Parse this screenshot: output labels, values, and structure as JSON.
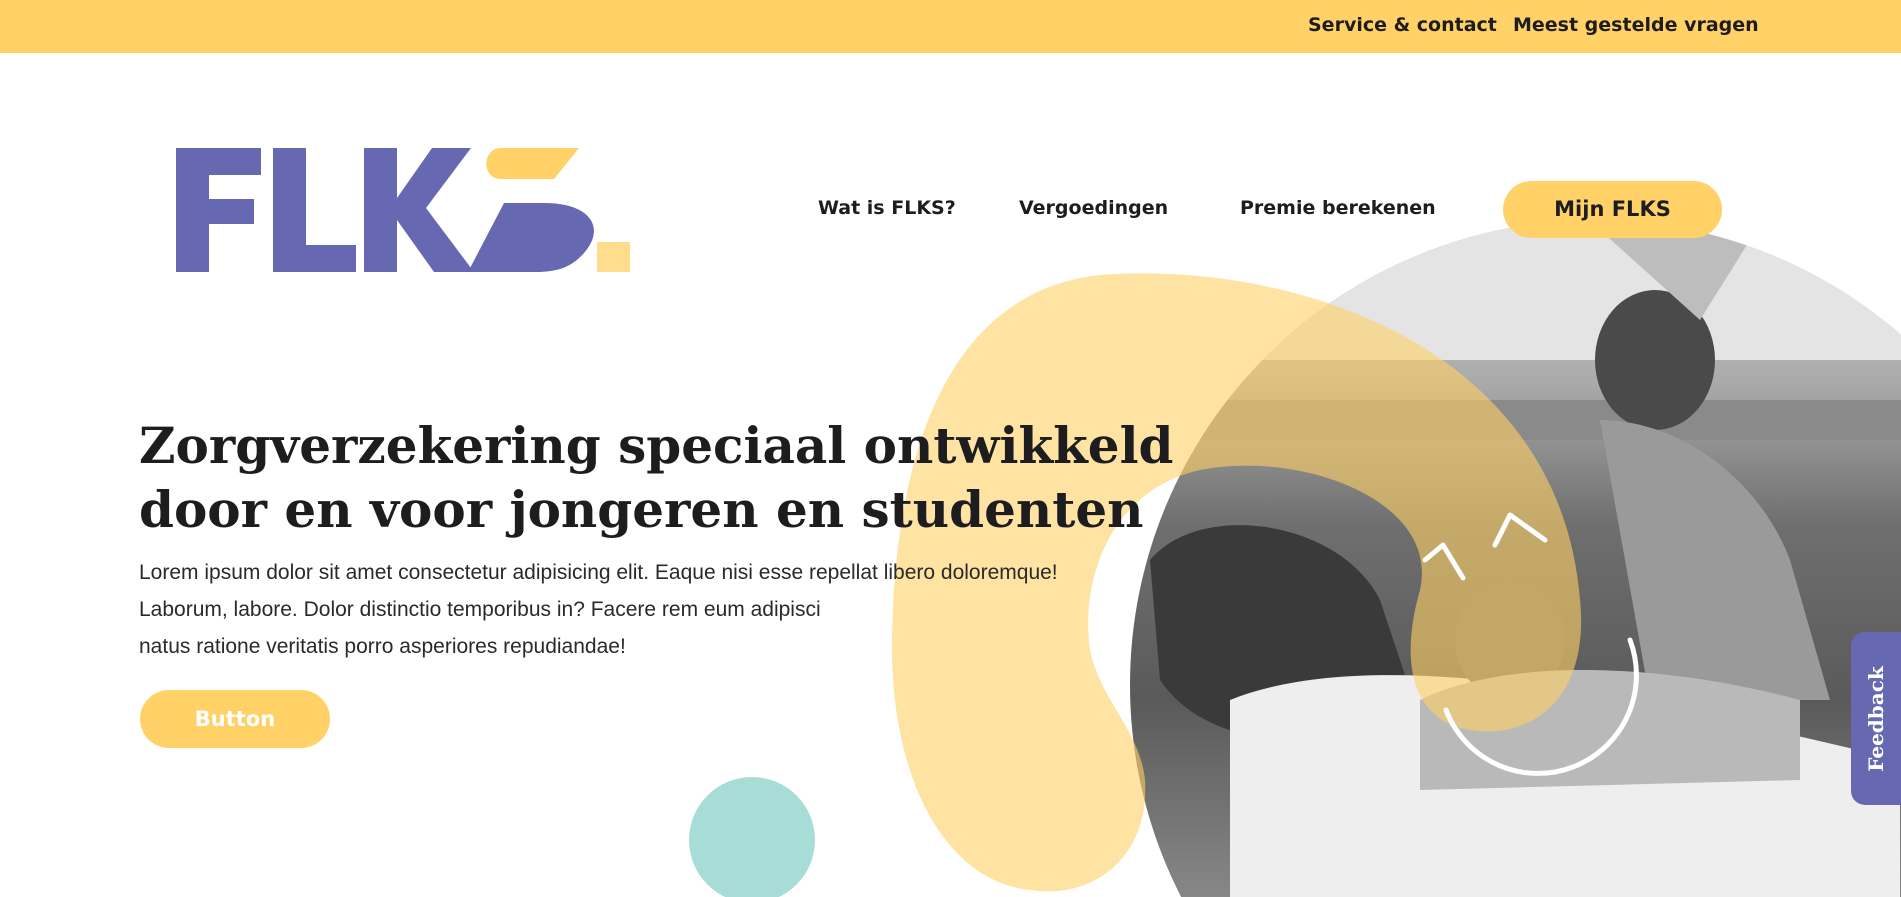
{
  "top_bar": {
    "links": [
      "Service & contact",
      "Meest gestelde vragen"
    ]
  },
  "logo": {
    "letters": "FLKS."
  },
  "nav": {
    "items": [
      "Wat is FLKS?",
      "Vergoedingen",
      "Premie berekenen"
    ],
    "cta_label": "Mijn FLKS"
  },
  "hero": {
    "title_lines": [
      "Zorgverzekering speciaal ontwikkeld",
      "door en voor jongeren en studenten"
    ],
    "body_lines": [
      "Lorem ipsum dolor sit amet consectetur adipisicing elit. Eaque nisi esse repellat libero doloremque!",
      "Laborum, labore. Dolor distinctio temporibus in? Facere rem eum adipisci",
      "natus ratione veritatis porro asperiores repudiandae!"
    ],
    "button_label": "Button"
  },
  "feedback": {
    "label": "Feedback"
  },
  "colors": {
    "yellow": "#ffd166",
    "light_yellow": "#ffe3a0",
    "purple": "#6768b2",
    "teal": "#a8dcd6",
    "text": "#1d1d1f"
  }
}
